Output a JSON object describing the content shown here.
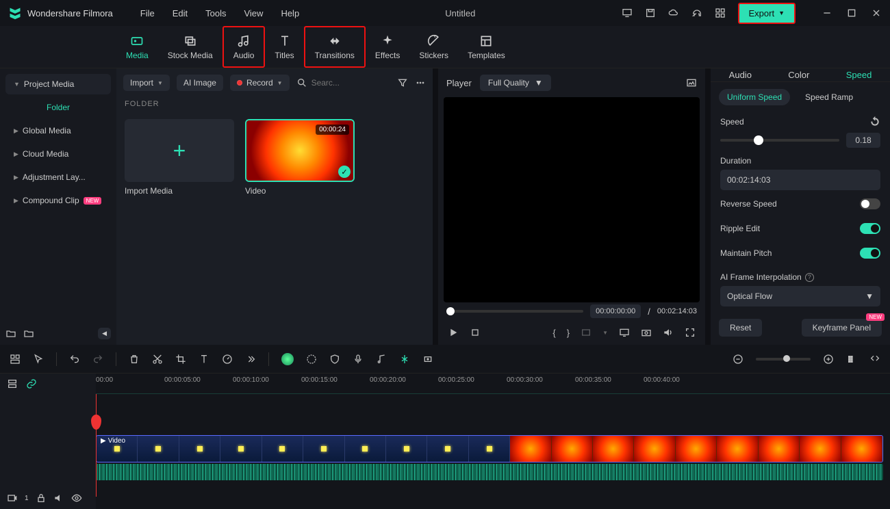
{
  "app_name": "Wondershare Filmora",
  "menu": [
    "File",
    "Edit",
    "Tools",
    "View",
    "Help"
  ],
  "document_title": "Untitled",
  "export_label": "Export",
  "tabs": [
    {
      "label": "Media",
      "active": true
    },
    {
      "label": "Stock Media"
    },
    {
      "label": "Audio",
      "highlight": true
    },
    {
      "label": "Titles"
    },
    {
      "label": "Transitions",
      "highlight": true
    },
    {
      "label": "Effects"
    },
    {
      "label": "Stickers"
    },
    {
      "label": "Templates"
    }
  ],
  "sidebar": {
    "project_media": "Project Media",
    "folder": "Folder",
    "items": [
      "Global Media",
      "Cloud Media",
      "Adjustment Lay...",
      "Compound Clip"
    ]
  },
  "mid_toolbar": {
    "import": "Import",
    "ai_image": "AI Image",
    "record": "Record",
    "search_ph": "Searc..."
  },
  "folder_header": "FOLDER",
  "thumb_import": "Import Media",
  "thumb_video": {
    "label": "Video",
    "duration": "00:00:24"
  },
  "player": {
    "label": "Player",
    "quality": "Full Quality",
    "cur": "00:00:00:00",
    "sep": "/",
    "total": "00:02:14:03"
  },
  "right": {
    "tabs": [
      "Audio",
      "Color",
      "Speed"
    ],
    "sub_tabs": [
      "Uniform Speed",
      "Speed Ramp"
    ],
    "speed_label": "Speed",
    "speed_val": "0.18",
    "duration_label": "Duration",
    "duration_val": "00:02:14:03",
    "reverse": "Reverse Speed",
    "ripple": "Ripple Edit",
    "pitch": "Maintain Pitch",
    "ai_interp": "AI Frame Interpolation",
    "ai_method": "Optical Flow",
    "reset": "Reset",
    "keyframe": "Keyframe Panel",
    "new": "NEW"
  },
  "timeline": {
    "ticks": [
      "00:00",
      "00:00:05:00",
      "00:00:10:00",
      "00:00:15:00",
      "00:00:20:00",
      "00:00:25:00",
      "00:00:30:00",
      "00:00:35:00",
      "00:00:40:00"
    ],
    "clip_label": "Video",
    "track_badge": "1"
  }
}
